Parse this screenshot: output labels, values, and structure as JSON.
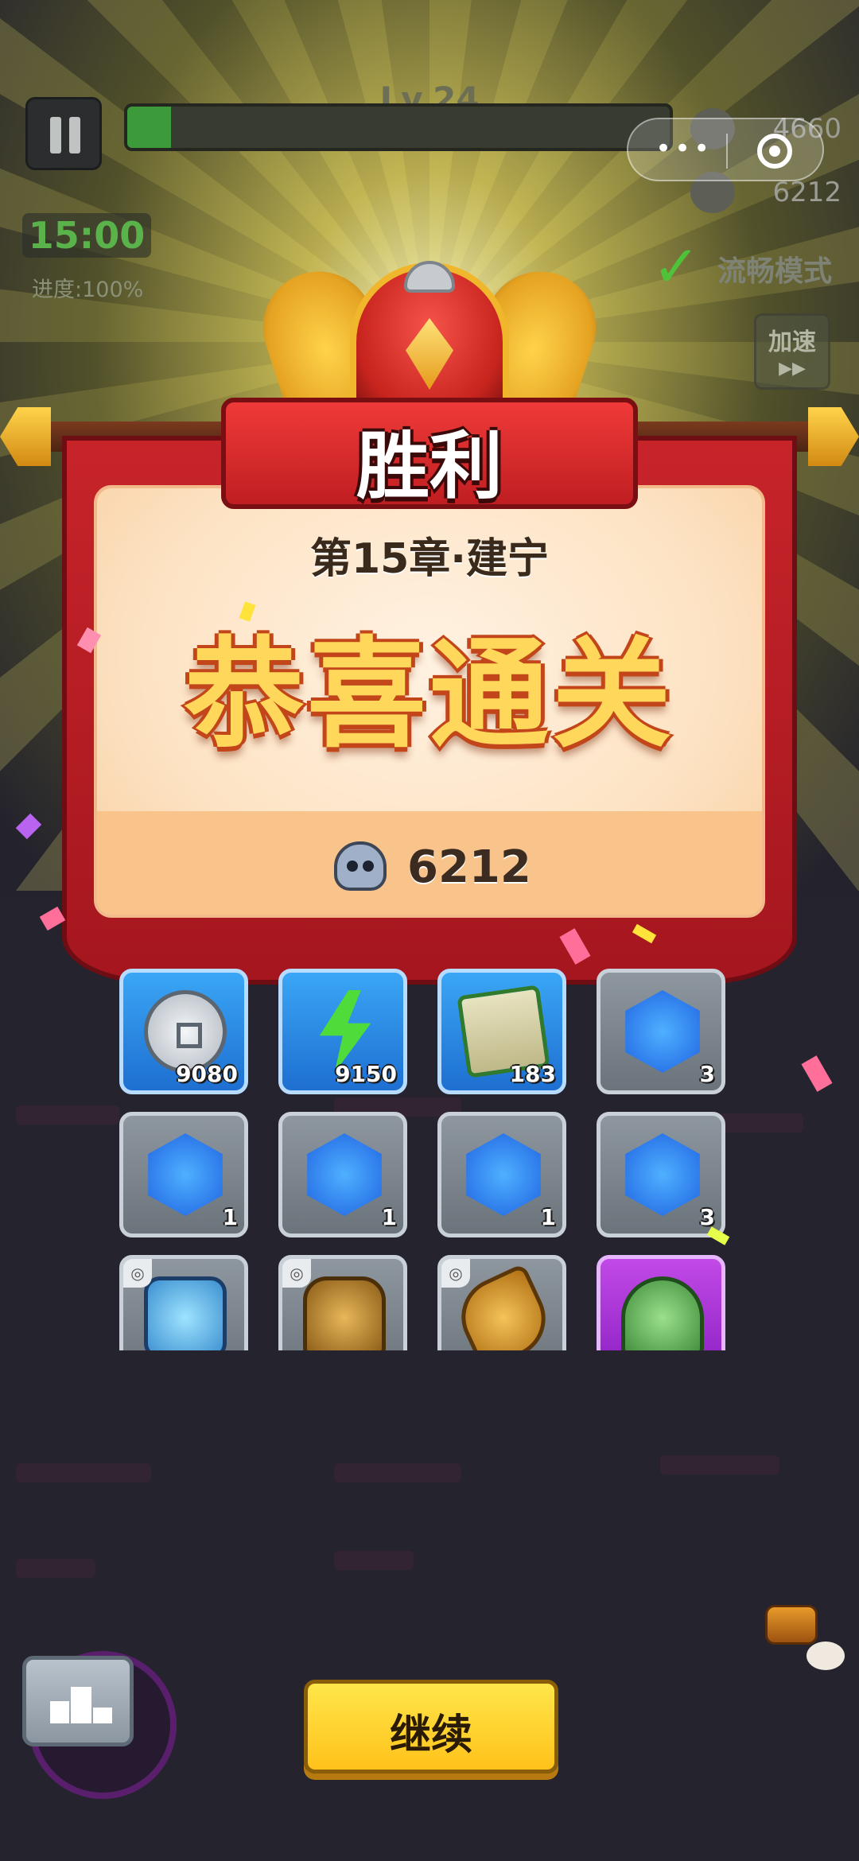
{
  "hud": {
    "level": "Lv.24",
    "xp_progress": 0.08,
    "timer": "15:00",
    "progress": "进度:100%",
    "coins": "4660",
    "kills": "6212",
    "smooth_mode": "流畅模式",
    "speed_label": "加速",
    "speed_arrow": "▶▶",
    "check_glyph": "✓"
  },
  "result": {
    "title": "胜利",
    "chapter": "第15章·建宁",
    "congrats": "恭喜通关",
    "kills": "6212"
  },
  "rewards": [
    {
      "icon": "silver-coin-icon",
      "rarity": "blue",
      "count": "9080"
    },
    {
      "icon": "energy-bolt-icon",
      "rarity": "blue",
      "count": "9150"
    },
    {
      "icon": "scroll-icon",
      "rarity": "blue",
      "count": "183"
    },
    {
      "icon": "armor-gem-icon",
      "rarity": "gray",
      "count": "3"
    },
    {
      "icon": "necklace-gem-icon",
      "rarity": "gray",
      "count": "1"
    },
    {
      "icon": "boots-gem-icon",
      "rarity": "gray",
      "count": "1"
    },
    {
      "icon": "glove-gem-icon",
      "rarity": "gray",
      "count": "1"
    },
    {
      "icon": "helmet-gem-icon",
      "rarity": "gray",
      "count": "3"
    },
    {
      "icon": "amulet-icon",
      "rarity": "gray",
      "count": ""
    },
    {
      "icon": "armor-icon",
      "rarity": "gray",
      "count": ""
    },
    {
      "icon": "gauntlet-icon",
      "rarity": "gray",
      "count": ""
    },
    {
      "icon": "jade-turtle-seal-icon",
      "rarity": "purple",
      "count": ""
    }
  ],
  "buttons": {
    "continue": "继续"
  },
  "colors": {
    "accent_yellow": "#ffd75a",
    "banner_red": "#c7242a",
    "rare_blue": "#1e6fd1",
    "epic_purple": "#8a1fc2",
    "timer_green": "#5ab24a"
  }
}
